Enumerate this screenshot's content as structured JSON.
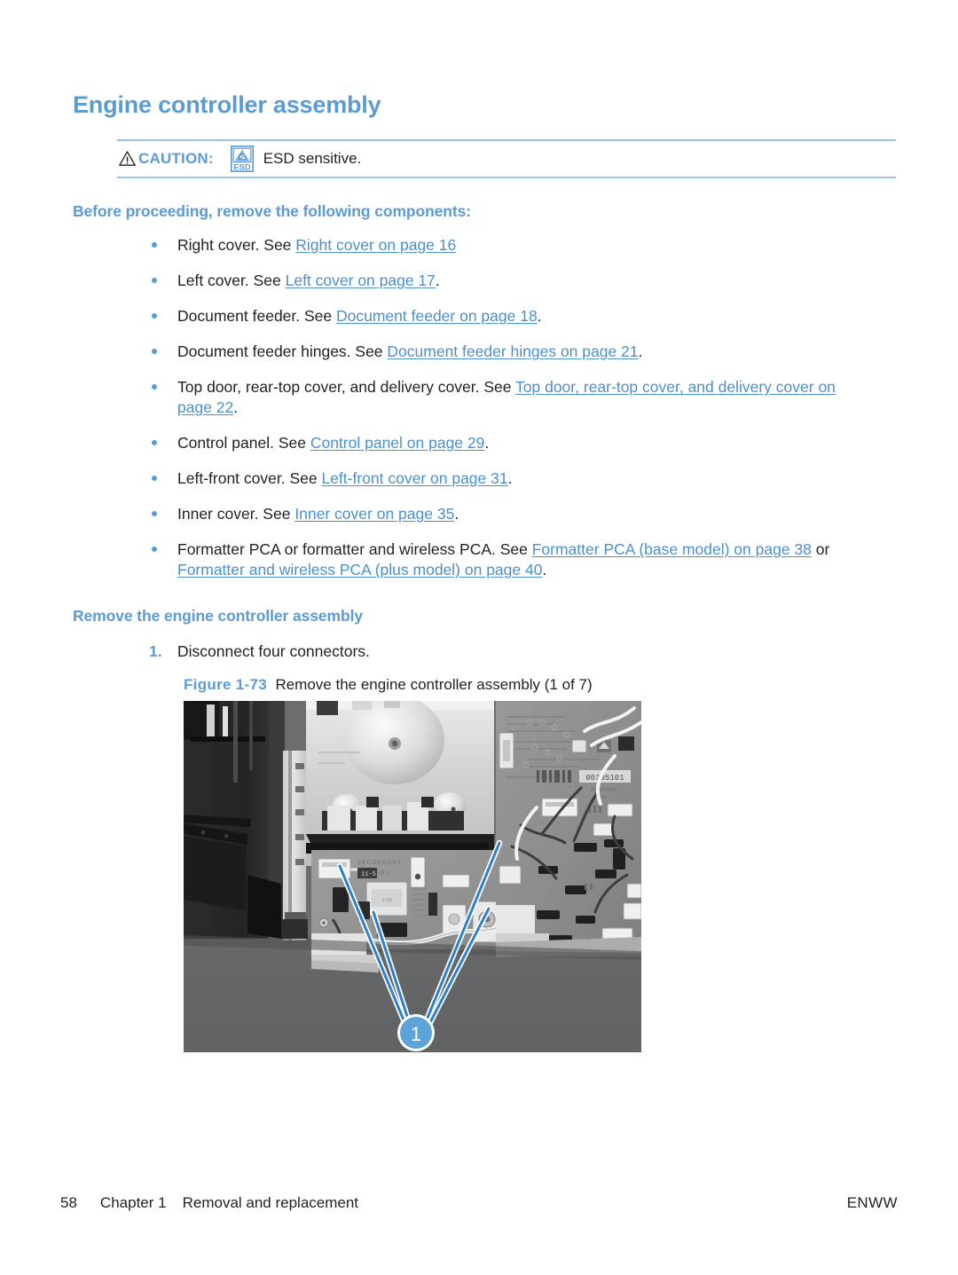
{
  "page_title": "Engine controller assembly",
  "caution": {
    "label": "CAUTION:",
    "text": "ESD sensitive.",
    "warn_icon": "warning-triangle-icon",
    "esd_icon": "esd-sensitive-icon",
    "esd_icon_text": "ESD",
    "rule_color": "#9CC3E5"
  },
  "before_heading": "Before proceeding, remove the following components:",
  "bullets": [
    {
      "pre": "Right cover. See ",
      "link": "Right cover on page 16",
      "post": ""
    },
    {
      "pre": "Left cover. See ",
      "link": "Left cover on page 17",
      "post": "."
    },
    {
      "pre": "Document feeder. See ",
      "link": "Document feeder on page 18",
      "post": "."
    },
    {
      "pre": "Document feeder hinges. See ",
      "link": "Document feeder hinges on page 21",
      "post": "."
    },
    {
      "pre": "Top door, rear-top cover, and delivery cover. See ",
      "link": "Top door, rear-top cover, and delivery cover on page 22",
      "post": "."
    },
    {
      "pre": "Control panel. See ",
      "link": "Control panel on page 29",
      "post": "."
    },
    {
      "pre": "Left-front cover. See ",
      "link": "Left-front cover on page 31",
      "post": "."
    },
    {
      "pre": "Inner cover. See ",
      "link": "Inner cover on page 35",
      "post": "."
    },
    {
      "pre": "Formatter PCA or formatter and wireless PCA. See ",
      "link": "Formatter PCA (base model) on page 38",
      "mid": " or ",
      "link2": "Formatter and wireless PCA (plus model) on page 40",
      "post": "."
    }
  ],
  "remove_heading": "Remove the engine controller assembly",
  "step": {
    "number": "1.",
    "text": "Disconnect four connectors."
  },
  "figure": {
    "label": "Figure 1-73",
    "caption": "Remove the engine controller assembly (1 of 7)",
    "callout_number": "1",
    "pcb_label": "00305101",
    "silkscreen_secondary": "SECONDARY",
    "silkscreen_primary": "PRIMARY"
  },
  "footer": {
    "page_number": "58",
    "chapter": "Chapter 1",
    "chapter_title": "Removal and replacement",
    "publisher": "ENWW"
  },
  "colors": {
    "accent_blue": "#5B9BD5",
    "link_blue": "#4B8FCF",
    "rule_blue": "#9CC3E5",
    "body_black": "#231f20"
  }
}
